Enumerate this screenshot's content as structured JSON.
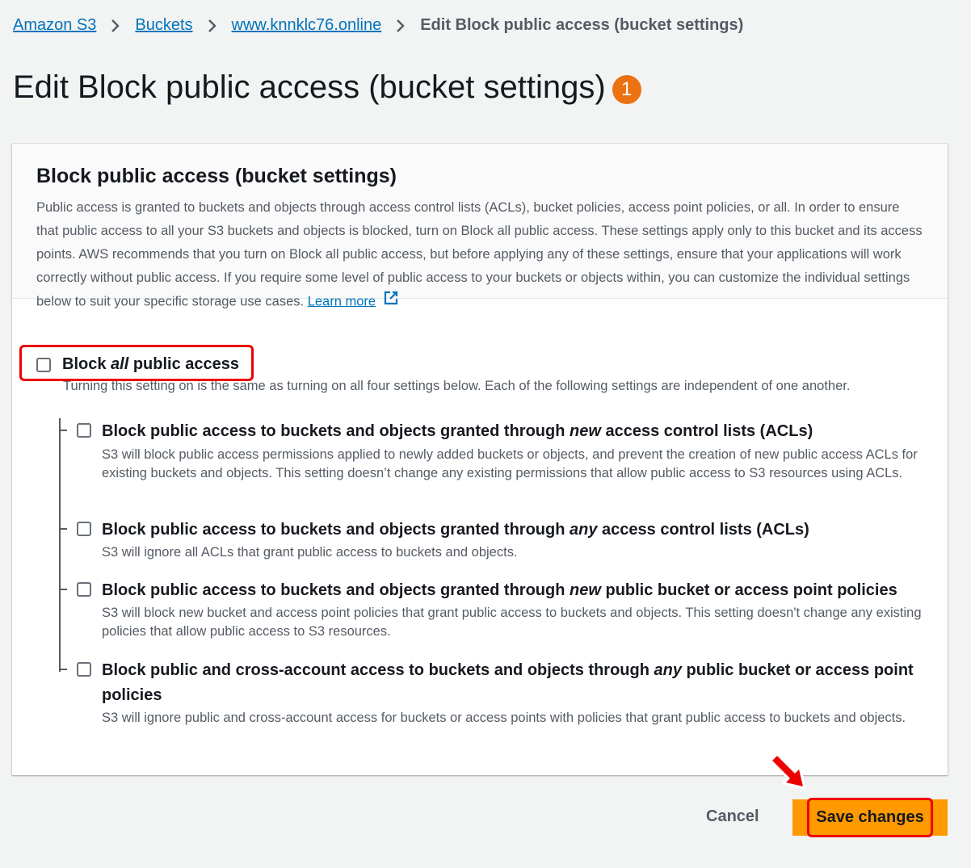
{
  "breadcrumb": {
    "items": [
      "Amazon S3",
      "Buckets",
      "www.knnklc76.online"
    ],
    "current": "Edit Block public access (bucket settings)"
  },
  "page": {
    "title": "Edit Block public access (bucket settings)",
    "step_badge": "1"
  },
  "panel": {
    "title": "Block public access (bucket settings)",
    "description": "Public access is granted to buckets and objects through access control lists (ACLs), bucket policies, access point policies, or all. In order to ensure that public access to all your S3 buckets and objects is blocked, turn on Block all public access. These settings apply only to this bucket and its access points. AWS recommends that you turn on Block all public access, but before applying any of these settings, ensure that your applications will work correctly without public access. If you require some level of public access to your buckets or objects within, you can customize the individual settings below to suit your specific storage use cases.",
    "learn_more": "Learn more"
  },
  "master": {
    "label_pre": "Block ",
    "label_em": "all",
    "label_post": " public access",
    "checked": false,
    "description": "Turning this setting on is the same as turning on all four settings below. Each of the following settings are independent of one another."
  },
  "settings": [
    {
      "title_pre": "Block public access to buckets and objects granted through ",
      "title_em": "new",
      "title_post": " access control lists (ACLs)",
      "description": "S3 will block public access permissions applied to newly added buckets or objects, and prevent the creation of new public access ACLs for existing buckets and objects. This setting doesn’t change any existing permissions that allow public access to S3 resources using ACLs.",
      "checked": false
    },
    {
      "title_pre": "Block public access to buckets and objects granted through ",
      "title_em": "any",
      "title_post": " access control lists (ACLs)",
      "description": "S3 will ignore all ACLs that grant public access to buckets and objects.",
      "checked": false
    },
    {
      "title_pre": "Block public access to buckets and objects granted through ",
      "title_em": "new",
      "title_post": " public bucket or access point policies",
      "description": "S3 will block new bucket and access point policies that grant public access to buckets and objects. This setting doesn't change any existing policies that allow public access to S3 resources.",
      "checked": false
    },
    {
      "title_pre": "Block public and cross-account access to buckets and objects through ",
      "title_em": "any",
      "title_post": " public bucket or access point policies",
      "description": "S3 will ignore public and cross-account access for buckets or access points with policies that grant public access to buckets and objects.",
      "checked": false
    }
  ],
  "actions": {
    "cancel": "Cancel",
    "save": "Save changes"
  },
  "colors": {
    "link": "#0073bb",
    "primary_button": "#ff9900",
    "highlight": "#e00000",
    "badge": "#ec7211"
  }
}
